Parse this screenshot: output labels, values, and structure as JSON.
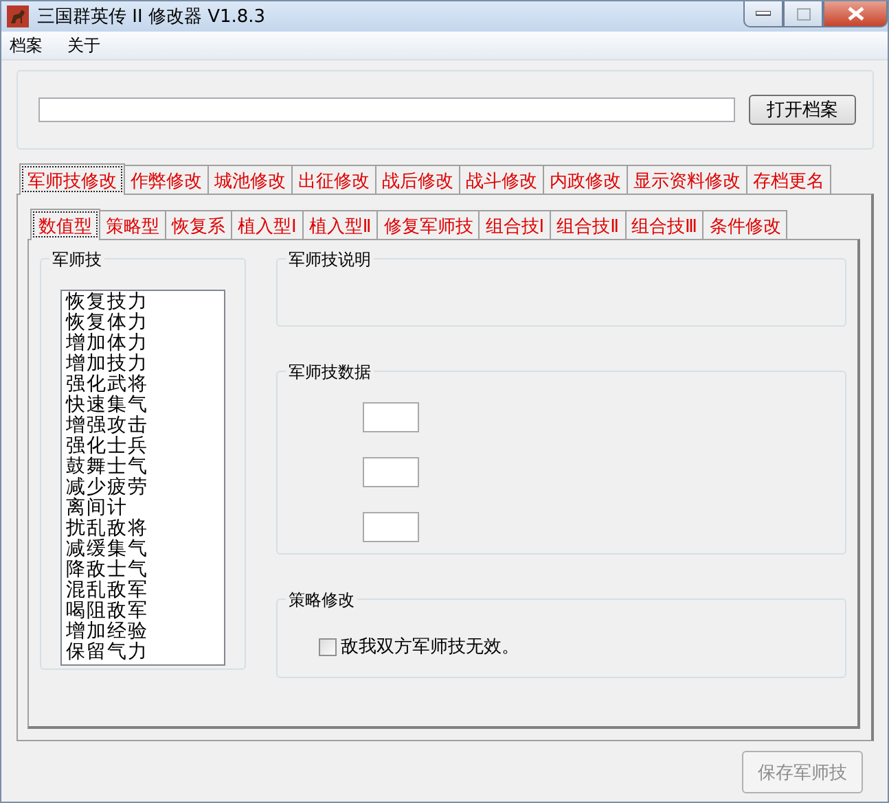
{
  "window": {
    "title": "三国群英传 II 修改器 V1.8.3"
  },
  "menu": [
    "档案",
    "关于"
  ],
  "file_bar": {
    "open_button": "打开档案"
  },
  "tabs": [
    {
      "label": "军师技修改",
      "selected": true
    },
    {
      "label": "作弊修改",
      "selected": false
    },
    {
      "label": "城池修改",
      "selected": false
    },
    {
      "label": "出征修改",
      "selected": false
    },
    {
      "label": "战后修改",
      "selected": false
    },
    {
      "label": "战斗修改",
      "selected": false
    },
    {
      "label": "内政修改",
      "selected": false
    },
    {
      "label": "显示资料修改",
      "selected": false
    },
    {
      "label": "存档更名",
      "selected": false
    }
  ],
  "subtabs": [
    {
      "label": "数值型",
      "selected": true
    },
    {
      "label": "策略型",
      "selected": false
    },
    {
      "label": "恢复系",
      "selected": false
    },
    {
      "label": "植入型Ⅰ",
      "selected": false
    },
    {
      "label": "植入型Ⅱ",
      "selected": false
    },
    {
      "label": "修复军师技",
      "selected": false
    },
    {
      "label": "组合技Ⅰ",
      "selected": false
    },
    {
      "label": "组合技Ⅱ",
      "selected": false
    },
    {
      "label": "组合技Ⅲ",
      "selected": false
    },
    {
      "label": "条件修改",
      "selected": false
    }
  ],
  "skill_group": {
    "title": "军师技",
    "items": [
      "恢复技力",
      "恢复体力",
      "增加体力",
      "增加技力",
      "强化武将",
      "快速集气",
      "增强攻击",
      "强化士兵",
      "鼓舞士气",
      "减少疲劳",
      "离间计",
      "扰乱敌将",
      "减缓集气",
      "降敌士气",
      "混乱敌军",
      "喝阻敌军",
      "增加经验",
      "保留气力"
    ]
  },
  "description_group": {
    "title": "军师技说明"
  },
  "data_group": {
    "title": "军师技数据"
  },
  "strategy_group": {
    "title": "策略修改",
    "checkbox": {
      "label": "敌我双方军师技无效。",
      "checked": false
    }
  },
  "save_button": {
    "label": "保存军师技",
    "disabled": true
  }
}
